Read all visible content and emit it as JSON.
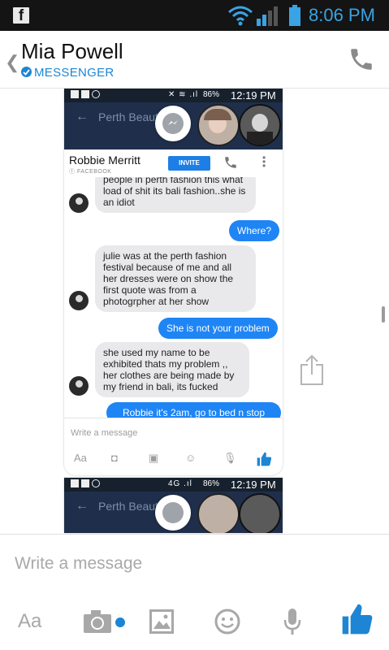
{
  "status_bar": {
    "time": "8:06 PM",
    "fb_letter": "f"
  },
  "header": {
    "back_glyph": "❮",
    "contact_name": "Mia Powell",
    "subtitle": "MESSENGER",
    "phone_icon": "phone-icon"
  },
  "embedded_screenshot": {
    "status": {
      "battery": "86%",
      "time": "12:19 PM",
      "signal": "4G"
    },
    "top_bar_title": "Perth Beaut",
    "card": {
      "name": "Robbie Merritt",
      "source": "FACEBOOK",
      "invite_label": "INVITE"
    },
    "messages": [
      {
        "from": "them",
        "text": "people in perth fashion this what load of shit its bali fashion..she is an idiot"
      },
      {
        "from": "me",
        "text": "Where?"
      },
      {
        "from": "them",
        "text": "julie was at the perth fashion festival because of me and all her dresses were on show the first quote was from a photogrpher at her show"
      },
      {
        "from": "me",
        "text": "She is not your problem"
      },
      {
        "from": "them",
        "text": "she used my name to be exhibited thats my problem ,, her clothes are being made by my friend in bali, its fucked"
      },
      {
        "from": "me",
        "text": "Robbie it's 2am, go to bed n stop"
      }
    ],
    "input_placeholder": "Write a message",
    "toolbar_aa": "Aa"
  },
  "compose": {
    "placeholder": "Write a message",
    "aa_label": "Aa",
    "colors": {
      "accent": "#1d85d4",
      "bubble_blue": "#1f85f5"
    }
  }
}
